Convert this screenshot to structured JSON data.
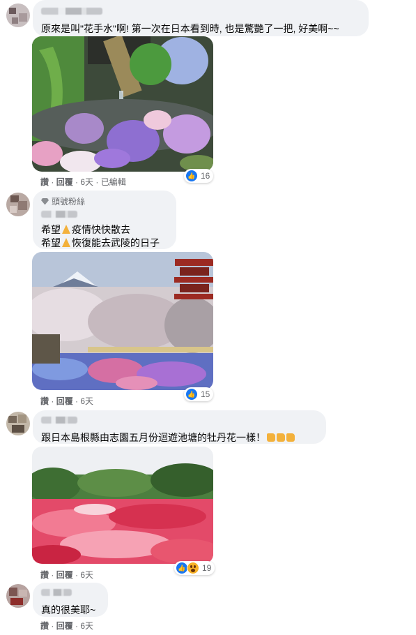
{
  "comments": [
    {
      "text": "原來是叫\"花手水\"啊! 第一次在日本看到時, 也是驚艷了一把, 好美啊~~",
      "reaction_count": "16",
      "actions": {
        "like": "讚",
        "reply": "回覆",
        "time": "6天",
        "edited": "已編輯"
      }
    },
    {
      "badge": "頭號粉絲",
      "line1_a": "希望",
      "line1_b": "疫情快快散去",
      "line2_a": "希望",
      "line2_b": "恢復能去武陵的日子",
      "reaction_count": "15",
      "actions": {
        "like": "讚",
        "reply": "回覆",
        "time": "6天"
      }
    },
    {
      "text": "跟日本島根縣由志園五月份迴遊池塘的牡丹花一樣！",
      "reaction_count": "19",
      "actions": {
        "like": "讚",
        "reply": "回覆",
        "time": "6天"
      }
    },
    {
      "text": "真的很美耶~",
      "actions": {
        "like": "讚",
        "reply": "回覆",
        "time": "6天"
      }
    }
  ],
  "separator": " · ",
  "icons": {
    "like": "thumbs-up-icon",
    "wow": "wow-face-icon",
    "badge": "diamond-icon",
    "pray": "folded-hands-icon",
    "thumbs": "thumbs-up-emoji-icon"
  },
  "colors": {
    "bubble": "#f0f2f5",
    "like_blue": "#1877f2",
    "meta_gray": "#65676b"
  }
}
